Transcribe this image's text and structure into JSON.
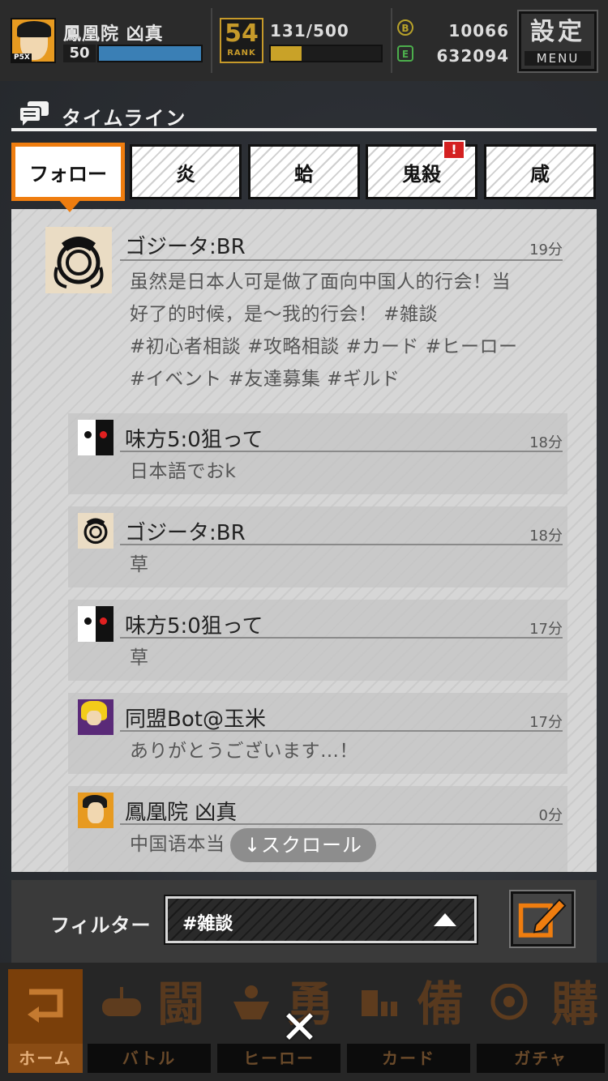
{
  "status_bar": {
    "player_name": "鳳凰院 凶真",
    "level": "50",
    "xp_fraction": 1.0,
    "rank_number": "54",
    "rank_label": "RANK",
    "stamina": "131/500",
    "stamina_fraction": 0.28,
    "currency_b_icon": "B",
    "currency_b": "10066",
    "currency_e_icon": "E",
    "currency_e": "632094",
    "menu_kanji": "設定",
    "menu_label": "MENU"
  },
  "timeline": {
    "title": "タイムライン",
    "icon": "chat-bubbles-icon"
  },
  "tabs": [
    {
      "label": "フォロー",
      "active": true
    },
    {
      "label": "炎",
      "active": false
    },
    {
      "label": "蛤",
      "active": false
    },
    {
      "label": "鬼殺",
      "active": false,
      "alert": "!"
    },
    {
      "label": "咸",
      "active": false
    }
  ],
  "posts": [
    {
      "author": "ゴジータ:BR",
      "time": "19分",
      "avatar": "dragon-emblem",
      "body_lines": [
        "虽然是日本人可是做了面向中国人的行会！当",
        "好了的时候，是〜我的行会！ #雑談",
        "#初心者相談 #攻略相談 #カード #ヒーロー",
        "#イベント #友達募集 #ギルド"
      ]
    },
    {
      "author": "味方5:0狙って",
      "time": "18分",
      "avatar": "black-white-bear",
      "body": "日本語でおk"
    },
    {
      "author": "ゴジータ:BR",
      "time": "18分",
      "avatar": "dragon-emblem",
      "body": "草"
    },
    {
      "author": "味方5:0狙って",
      "time": "17分",
      "avatar": "black-white-bear",
      "body": "草"
    },
    {
      "author": "同盟Bot@玉米",
      "time": "17分",
      "avatar": "blonde-character",
      "body": "ありがとうございます…！"
    },
    {
      "author": "鳳凰院 凶真",
      "time": "0分",
      "avatar": "hero-character",
      "body": "中国语本当"
    }
  ],
  "scroll_hint": "↓スクロール",
  "filter": {
    "label": "フィルター",
    "value": "#雑談"
  },
  "bottom_nav": [
    {
      "label": "ホーム",
      "kanji": "",
      "icon": "home-return-icon"
    },
    {
      "label": "バトル",
      "kanji": "闘",
      "icon": "gamepad-icon"
    },
    {
      "label": "ヒーロー",
      "kanji": "勇",
      "icon": "hero-icon"
    },
    {
      "label": "カード",
      "kanji": "備",
      "icon": "cards-icon"
    },
    {
      "label": "ガチャ",
      "kanji": "購",
      "icon": "gacha-icon"
    }
  ],
  "close_label": "✕",
  "colors": {
    "accent_orange": "#ef7d0f",
    "alert_red": "#d42020",
    "xp_blue": "#3a7fb5",
    "stamina_gold": "#c9a228"
  }
}
